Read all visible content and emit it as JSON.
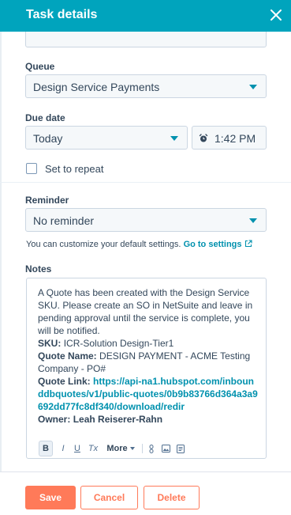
{
  "header": {
    "title": "Task details",
    "close_icon": "close-icon"
  },
  "queue": {
    "label": "Queue",
    "value": "Design Service Payments"
  },
  "due_date": {
    "label": "Due date",
    "date_value": "Today",
    "time_value": "1:42 PM",
    "time_icon": "alarm-clock-icon"
  },
  "repeat": {
    "label": "Set to repeat",
    "checked": false
  },
  "reminder": {
    "label": "Reminder",
    "value": "No reminder",
    "helper_text": "You can customize your default settings.",
    "helper_link": "Go to settings",
    "helper_link_icon": "external-link-icon"
  },
  "notes": {
    "label": "Notes",
    "intro": "A Quote has been created with the Design Service SKU. Please create an SO in NetSuite and leave in pending approval until the service is complete, you will be notified.",
    "sku_label": "SKU:",
    "sku_value": "ICR-Solution Design-Tier1",
    "quote_name_label": "Quote Name:",
    "quote_name_value": "DESIGN PAYMENT - ACME Testing Company - PO#",
    "quote_link_label": "Quote Link:",
    "quote_link_value": "https://api-na1.hubspot.com/inbounddbquotes/v1/public-quotes/0b9b83766d364a3a9692dd77fc8df340/download/redir",
    "owner_label": "Owner:",
    "owner_value": "Leah Reiserer-Rahn",
    "toolbar": {
      "bold": "B",
      "italic": "I",
      "underline": "U",
      "clear": "Tx",
      "more": "More"
    }
  },
  "footer": {
    "save": "Save",
    "cancel": "Cancel",
    "delete": "Delete"
  },
  "colors": {
    "header": "#00a4bd",
    "accent": "#ff7a59",
    "link": "#0091ae",
    "text": "#33475b"
  }
}
